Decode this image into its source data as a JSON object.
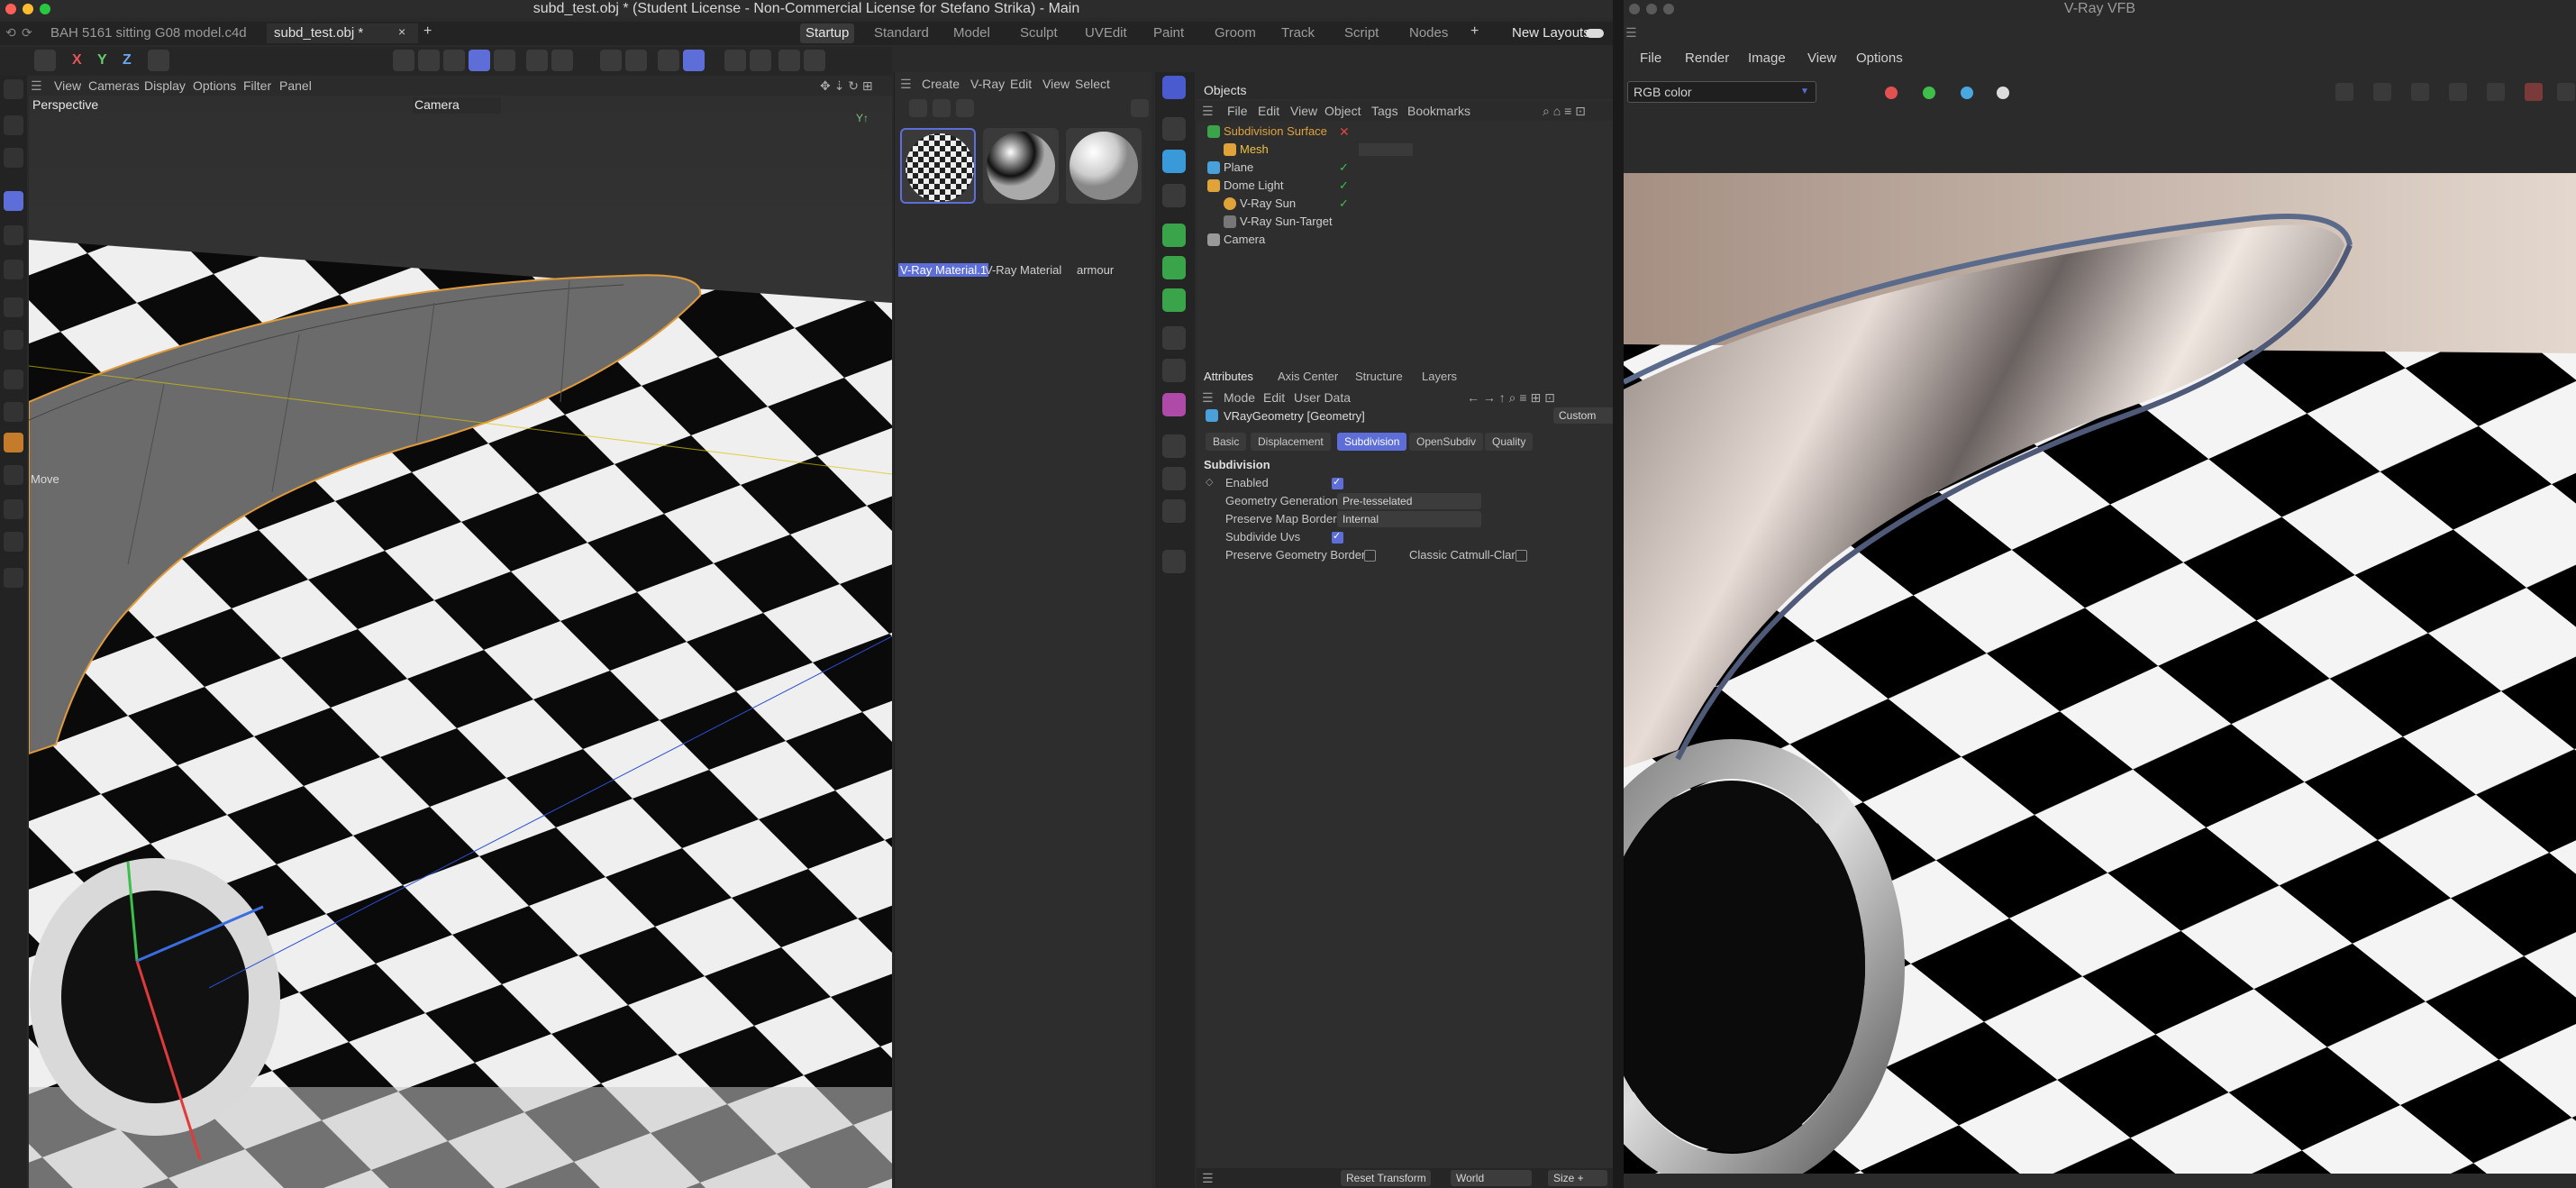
{
  "c4d": {
    "window_title": "subd_test.obj * (Student License - Non-Commercial License for Stefano Strika) - Main",
    "file_tabs": [
      "BAH 5161 sitting G08 model.c4d",
      "subd_test.obj *"
    ],
    "layout_tabs": [
      "Startup",
      "Standard",
      "Model",
      "Sculpt",
      "UVEdit",
      "Paint",
      "Groom",
      "Track",
      "Script",
      "Nodes"
    ],
    "new_layouts": "New Layouts",
    "axis_buttons": [
      "X",
      "Y",
      "Z"
    ],
    "viewport_menu": [
      "View",
      "Cameras",
      "Display",
      "Options",
      "Filter",
      "Panel"
    ],
    "viewport_name": "Perspective",
    "viewport_camera": "Camera",
    "move_label": "Move",
    "material_menu": [
      "Create",
      "V-Ray",
      "Edit",
      "View",
      "Select"
    ],
    "materials": [
      {
        "name": "V-Ray Material.1",
        "selected": true
      },
      {
        "name": "V-Ray Material",
        "selected": false
      },
      {
        "name": "armour",
        "selected": false
      }
    ],
    "objects_header": "Objects",
    "object_menu": [
      "File",
      "Edit",
      "View",
      "Object",
      "Tags",
      "Bookmarks"
    ],
    "objects": [
      {
        "name": "Subdivision Surface",
        "indent": 0,
        "color": "#e0a33a"
      },
      {
        "name": "Mesh",
        "indent": 1,
        "color": "#f0c040"
      },
      {
        "name": "Plane",
        "indent": 0,
        "color": "#cfcfcf"
      },
      {
        "name": "Dome Light",
        "indent": 0,
        "color": "#cfcfcf"
      },
      {
        "name": "V-Ray Sun",
        "indent": 1,
        "color": "#cfcfcf"
      },
      {
        "name": "V-Ray Sun-Target",
        "indent": 1,
        "color": "#cfcfcf"
      },
      {
        "name": "Camera",
        "indent": 0,
        "color": "#cfcfcf"
      }
    ],
    "attr_tabs": [
      "Attributes",
      "Axis Center",
      "Structure",
      "Layers"
    ],
    "attr_menu": [
      "Mode",
      "Edit",
      "User Data"
    ],
    "attr_object": "VRayGeometry [Geometry]",
    "attr_preset": "Custom",
    "attr_subtabs": [
      "Basic",
      "Displacement",
      "Subdivision",
      "OpenSubdiv",
      "Quality"
    ],
    "attr_active_subtab": "Subdivision",
    "section_title": "Subdivision",
    "fields": {
      "enabled_label": "Enabled",
      "geometry_generation_label": "Geometry Generation",
      "geometry_generation_value": "Pre-tesselated",
      "preserve_map_borders_label": "Preserve Map Borders",
      "preserve_map_borders_value": "Internal",
      "subdivide_uvs_label": "Subdivide Uvs",
      "preserve_geometry_borders_label": "Preserve Geometry Borders",
      "classic_catmull_label": "Classic Catmull-Clark"
    },
    "status": {
      "reset": "Reset Transform",
      "space": "World",
      "size": "Size +"
    }
  },
  "vfb": {
    "window_title": "V-Ray VFB",
    "menu": [
      "File",
      "Render",
      "Image",
      "View",
      "Options"
    ],
    "channel": "RGB color",
    "colors": {
      "red": "#e05252",
      "green": "#3fbf4a",
      "blue": "#4aa8e0"
    }
  },
  "accent": "#5d6ed8"
}
